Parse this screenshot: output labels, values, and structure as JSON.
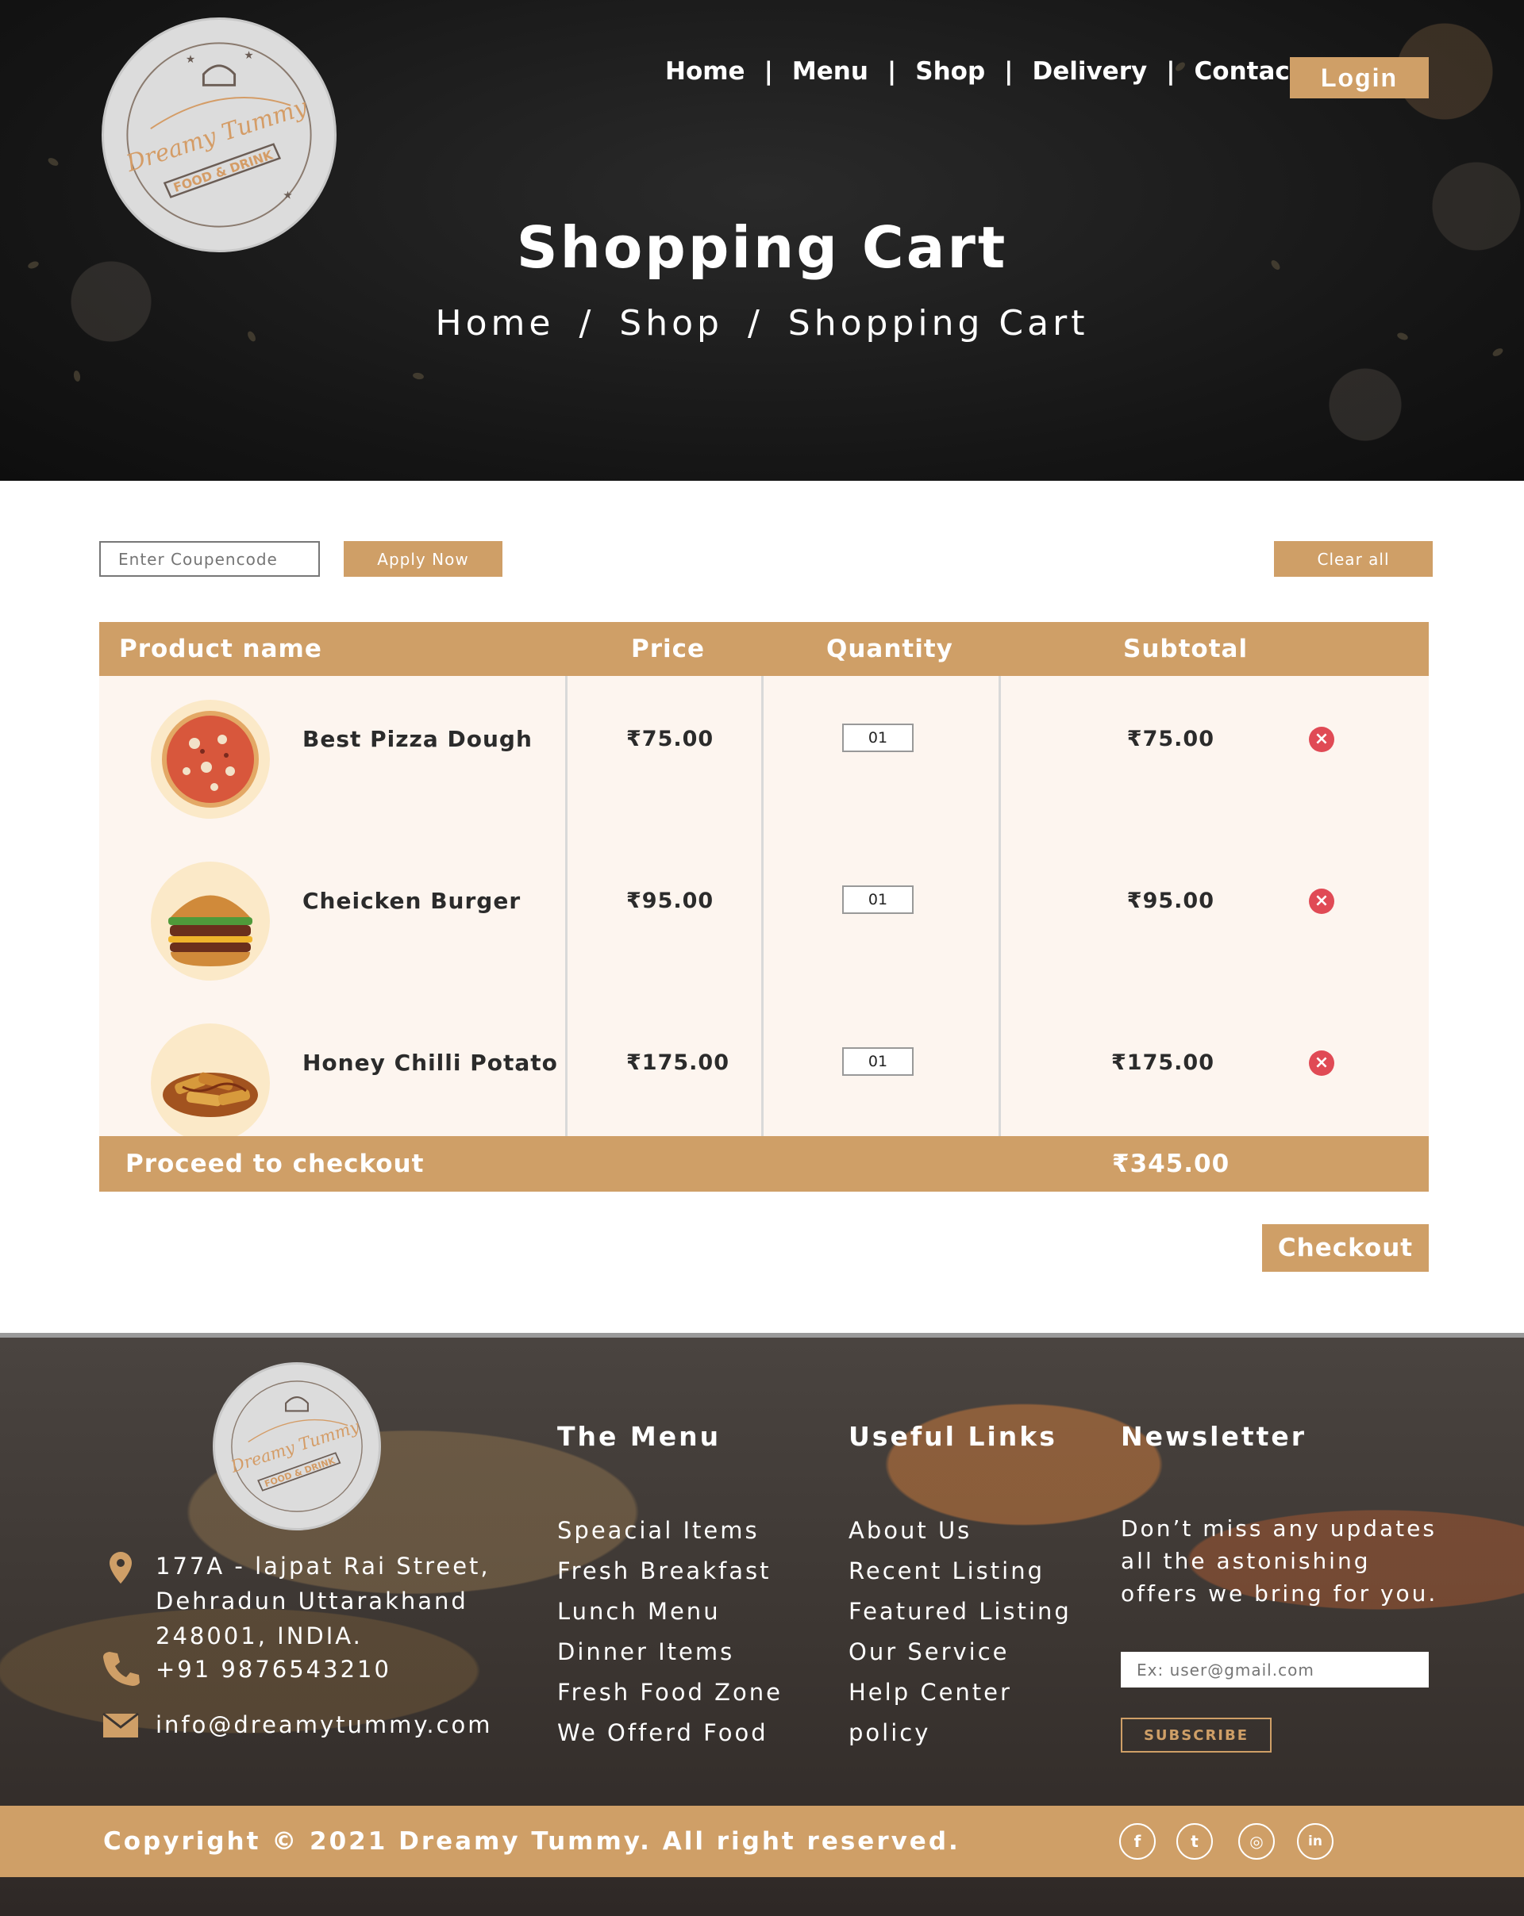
{
  "brand": {
    "logo_lines": [
      "Dreamy Tummy",
      "FOOD & DRINK"
    ]
  },
  "nav": {
    "items": [
      "Home",
      "Menu",
      "Shop",
      "Delivery",
      "Contact Us"
    ],
    "separator": "|",
    "login_label": "Login"
  },
  "hero": {
    "title": "Shopping Cart",
    "breadcrumb": [
      "Home",
      "Shop",
      "Shopping Cart"
    ],
    "breadcrumb_separator": "/"
  },
  "cart": {
    "coupon_placeholder": "Enter Coupencode",
    "apply_label": "Apply Now",
    "clear_label": "Clear all",
    "columns": [
      "Product name",
      "Price",
      "Quantity",
      "Subtotal"
    ],
    "rows": [
      {
        "name": "Best Pizza Dough",
        "price": "₹75.00",
        "qty": "01",
        "subtotal": "₹75.00",
        "icon": "pizza-icon"
      },
      {
        "name": "Cheicken Burger",
        "price": "₹95.00",
        "qty": "01",
        "subtotal": "₹95.00",
        "icon": "burger-icon"
      },
      {
        "name": "Honey Chilli Potato",
        "price": "₹175.00",
        "qty": "01",
        "subtotal": "₹175.00",
        "icon": "potato-icon"
      }
    ],
    "remove_symbol": "×",
    "footer_label": "Proceed to checkout",
    "total": "₹345.00",
    "checkout_label": "Checkout"
  },
  "footer": {
    "address": [
      "177A - lajpat Rai Street,",
      "Dehradun Uttarakhand",
      "248001, INDIA."
    ],
    "phone": "+91 9876543210",
    "email": "info@dreamytummy.com",
    "menu_title": "The Menu",
    "menu_links": [
      "Speacial Items",
      "Fresh Breakfast",
      "Lunch Menu",
      "Dinner Items",
      "Fresh Food Zone",
      "We Offerd Food"
    ],
    "useful_title": "Useful Links",
    "useful_links": [
      "About Us",
      "Recent Listing",
      "Featured Listing",
      "Our Service",
      "Help Center",
      "policy"
    ],
    "newsletter_title": "Newsletter",
    "newsletter_text": "Don’t miss any updates all the astonishing offers we bring for you.",
    "newsletter_placeholder": "Ex: user@gmail.com",
    "subscribe_label": "SUBSCRIBE",
    "copyright": "Copyright © 2021 Dreamy Tummy. All right reserved.",
    "social": [
      {
        "icon": "facebook-icon",
        "glyph": "f"
      },
      {
        "icon": "twitter-icon",
        "glyph": "t"
      },
      {
        "icon": "instagram-icon",
        "glyph": "◎"
      },
      {
        "icon": "linkedin-icon",
        "glyph": "in"
      }
    ]
  },
  "colors": {
    "accent": "#cf9f67",
    "row_bg": "#fdf5ef",
    "remove": "#e04a55",
    "hero_bg": "#151515"
  }
}
